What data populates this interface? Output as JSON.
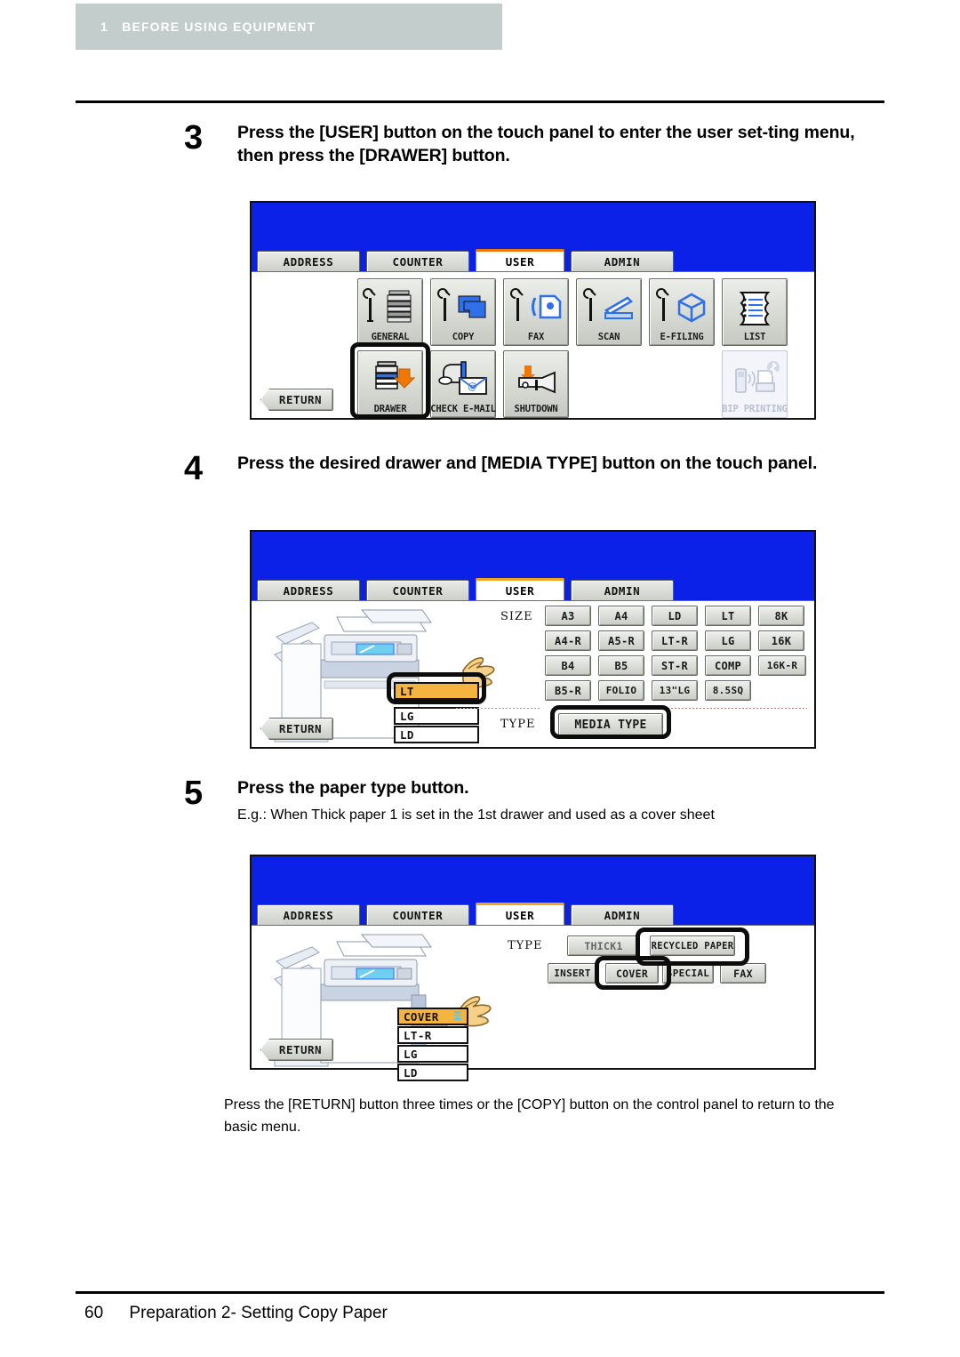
{
  "header": {
    "chapter_number": "1",
    "chapter_title": "BEFORE USING EQUIPMENT"
  },
  "steps": [
    {
      "number": "3",
      "title": "Press the [USER] button on the touch panel to enter the user set-ting menu, then press the [DRAWER] button.",
      "subtitle": ""
    },
    {
      "number": "4",
      "title": "Press the desired drawer and [MEDIA TYPE] button on the touch panel.",
      "subtitle": ""
    },
    {
      "number": "5",
      "title": "Press the paper type button.",
      "subtitle": "E.g.: When Thick paper 1 is set in the 1st drawer and used as a cover sheet"
    }
  ],
  "closing_paragraph": "Press the [RETURN] button three times or the [COPY] button on the control panel to return to the basic menu.",
  "footer": {
    "page_number": "60",
    "section_title": "Preparation 2- Setting Copy Paper"
  },
  "panel_common": {
    "tabs": [
      "ADDRESS",
      "COUNTER",
      "USER",
      "ADMIN"
    ],
    "active_tab": "USER",
    "return_label": "RETURN",
    "colors": {
      "panel_blue": "#0b21e8",
      "tab_active_orange": "#f07800",
      "tab_active_amber": "#f3a51a",
      "selected_amber": "#f5b33f",
      "button_face": "#d8dbd4"
    }
  },
  "panel_user_menu": {
    "row1": [
      {
        "label": "GENERAL",
        "icon": "wrench-mfp-icon",
        "disabled": false
      },
      {
        "label": "COPY",
        "icon": "wrench-copy-icon",
        "disabled": false
      },
      {
        "label": "FAX",
        "icon": "wrench-fax-icon",
        "disabled": false
      },
      {
        "label": "SCAN",
        "icon": "wrench-scan-icon",
        "disabled": false
      },
      {
        "label": "E-FILING",
        "icon": "wrench-box-icon",
        "disabled": false
      },
      {
        "label": "LIST",
        "icon": "list-pages-icon",
        "disabled": false
      }
    ],
    "row2": [
      {
        "label": "DRAWER",
        "icon": "drawer-arrow-icon",
        "disabled": false
      },
      {
        "label": "CHECK E-MAIL",
        "icon": "mailbox-envelope-icon",
        "disabled": false
      },
      {
        "label": "SHUTDOWN",
        "icon": "power-switch-icon",
        "disabled": false
      }
    ],
    "row2_right": {
      "label": "BIP PRINTING",
      "icon": "bluetooth-phone-printer-icon",
      "disabled": true
    },
    "highlighted_button": "DRAWER"
  },
  "panel_drawer_size": {
    "size_label": "SIZE",
    "type_label": "TYPE",
    "size_buttons": [
      [
        "A3",
        "A4",
        "LD",
        "LT",
        "8K"
      ],
      [
        "A4-R",
        "A5-R",
        "LT-R",
        "LG",
        "16K"
      ],
      [
        "B4",
        "B5",
        "ST-R",
        "COMP",
        "16K-R"
      ],
      [
        "B5-R",
        "FOLIO",
        "13\"LG",
        "8.5SQ"
      ]
    ],
    "media_type_button": "MEDIA TYPE",
    "drawers": [
      {
        "label": "LT",
        "selected": true
      },
      {
        "label": "LG",
        "selected": false
      },
      {
        "label": "LD",
        "selected": false
      }
    ],
    "highlighted": [
      "LT",
      "MEDIA TYPE"
    ]
  },
  "panel_paper_type": {
    "type_label": "TYPE",
    "type_buttons_row1": [
      "THICK1",
      "RECYCLED PAPER"
    ],
    "type_buttons_row2": [
      "INSERT",
      "COVER",
      "SPECIAL",
      "FAX"
    ],
    "drawers": [
      {
        "label": "COVER",
        "selected": true
      },
      {
        "label": "LT-R",
        "selected": false
      },
      {
        "label": "LG",
        "selected": false
      },
      {
        "label": "LD",
        "selected": false
      }
    ],
    "highlighted": [
      "RECYCLED PAPER",
      "COVER"
    ]
  }
}
